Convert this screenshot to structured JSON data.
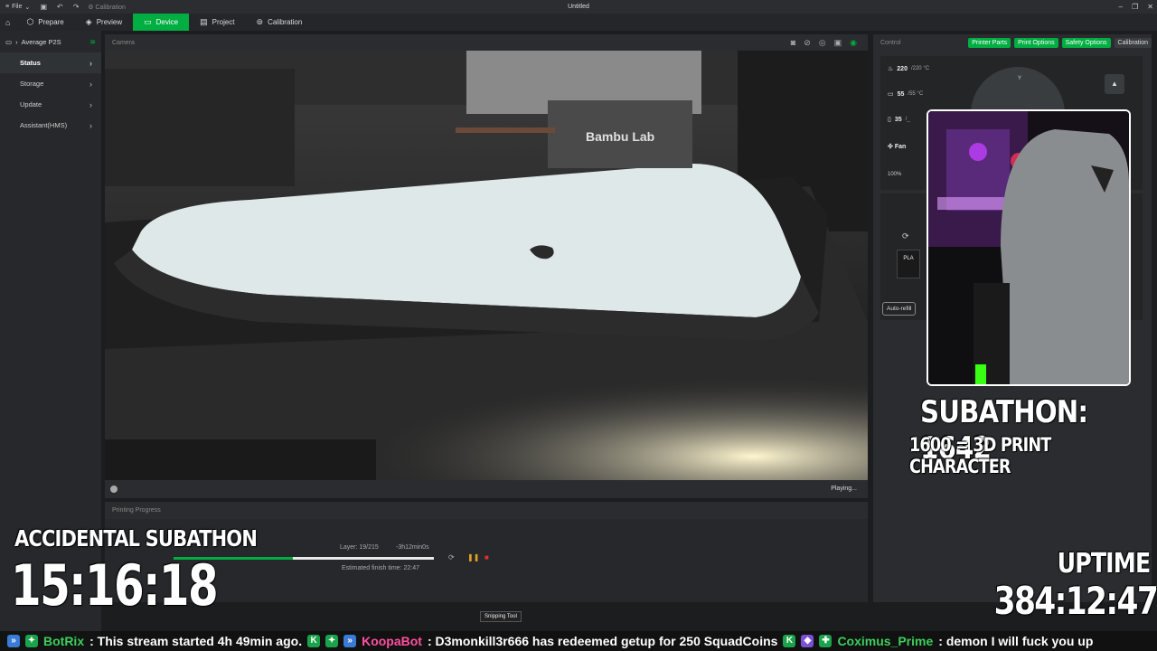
{
  "titlebar": {
    "file_label": "File",
    "calibration_label": "Calibration",
    "window_title": "Untitled"
  },
  "tabs": [
    {
      "label": "Prepare"
    },
    {
      "label": "Preview"
    },
    {
      "label": "Device"
    },
    {
      "label": "Project"
    },
    {
      "label": "Calibration"
    }
  ],
  "sidebar": {
    "device_name": "Average P2S",
    "items": [
      {
        "label": "Status"
      },
      {
        "label": "Storage"
      },
      {
        "label": "Update"
      },
      {
        "label": "Assistant(HMS)"
      }
    ]
  },
  "camera": {
    "title": "Camera",
    "status": "Playing...",
    "print_head_brand": "Bambu Lab"
  },
  "progress": {
    "title": "Printing Progress",
    "layer": "Layer: 19/215",
    "remaining": "-3h12min0s",
    "finish": "Estimated finish time: 22:47",
    "fraction": 0.46
  },
  "control": {
    "title": "Control",
    "buttons": [
      "Printer Parts",
      "Print Options",
      "Safety Options",
      "Calibration"
    ],
    "nozzle_temp": "220",
    "nozzle_target": "/220 °C",
    "bed_temp": "55",
    "bed_target": "/55 °C",
    "chamber_temp": "35",
    "chamber_target": "/_",
    "fan_label": "Fan",
    "fan_pct": "100%",
    "jog_y": "Y",
    "filament": "PLA",
    "autorefill": "Auto-refill"
  },
  "overlay": {
    "subathon": "SUBATHON: 1642",
    "subathon_note": "1600 = 3D PRINT CHARACTER",
    "accidental": "ACCIDENTAL SUBATHON",
    "timer": "15:16:18",
    "uptime_label": "UPTIME",
    "uptime_value": "384:12:47"
  },
  "snipping_tooltip": "Snipping Tool",
  "chat": {
    "user1": "BotRix",
    "msg1": ": This stream started 4h 49min ago.",
    "user2": "KoopaBot",
    "msg2": ": D3monkill3r666 has redeemed getup for 250 SquadCoins",
    "user3": "Coximus_Prime",
    "msg3": ": demon I will fuck you up"
  },
  "colors": {
    "accent": "#00ae42",
    "panel": "#2a2c2f"
  }
}
